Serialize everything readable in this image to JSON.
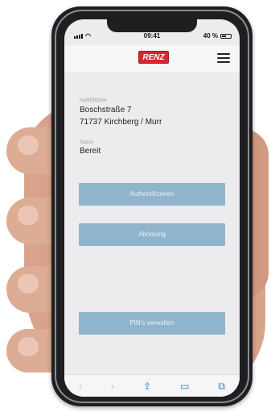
{
  "statusbar": {
    "time": "09:41",
    "battery": "40 %"
  },
  "brand": {
    "logo_text": "RENZ",
    "accent": "#d8262e"
  },
  "device": {
    "section_label": "myRENZbox",
    "street": "Boschstraße 7",
    "city": "71737 Kirchberg / Murr"
  },
  "status": {
    "label": "Status",
    "value": "Bereit"
  },
  "buttons": {
    "authenticate": "Authentifizieren",
    "pickup": "Abholung",
    "manage_pins": "PIN's verwalten"
  },
  "browser_toolbar": {
    "icons": [
      "back-arrow-icon",
      "forward-arrow-icon",
      "share-icon",
      "bookmarks-icon",
      "tabs-icon"
    ]
  },
  "colors": {
    "button_bg": "#8fb4cc",
    "button_text": "#e9f2f8"
  }
}
